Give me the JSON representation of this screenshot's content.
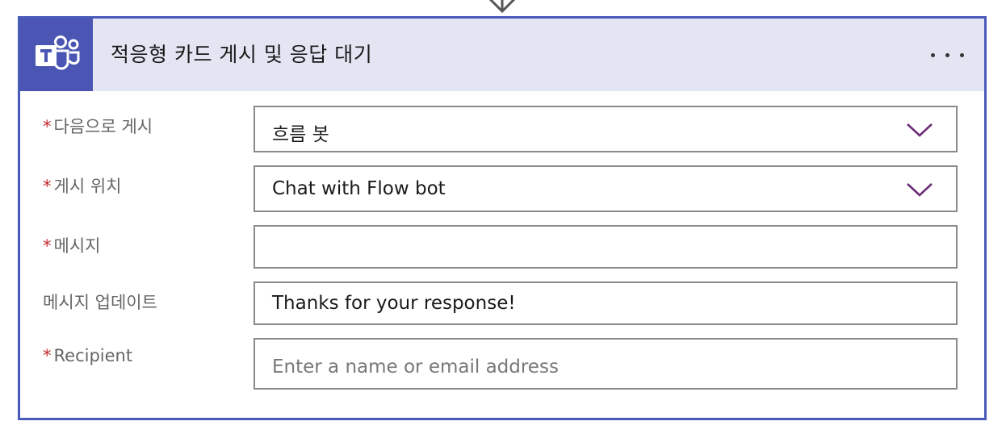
{
  "card": {
    "title": "적응형 카드 게시 및 응답 대기",
    "icon": "teams-logo-icon",
    "more_icon": "more-options-icon"
  },
  "colors": {
    "accent": "#4a5ab8",
    "header_bg": "#e3e5f3",
    "required": "#c4262e",
    "chevron": "#6b2c77"
  },
  "fields": {
    "post_as": {
      "label": "다음으로 게시",
      "required": true,
      "value": "흐름 봇",
      "type": "dropdown"
    },
    "post_in": {
      "label": "게시 위치",
      "required": true,
      "value": "Chat with Flow bot",
      "type": "dropdown"
    },
    "message": {
      "label": "메시지",
      "required": true,
      "value": "",
      "type": "text"
    },
    "update_message": {
      "label": "메시지 업데이트",
      "required": false,
      "value": "Thanks for your response!",
      "type": "text"
    },
    "recipient": {
      "label": "Recipient",
      "required": true,
      "value": "",
      "placeholder": "Enter a name or email address",
      "type": "text"
    }
  },
  "required_marker": "*"
}
